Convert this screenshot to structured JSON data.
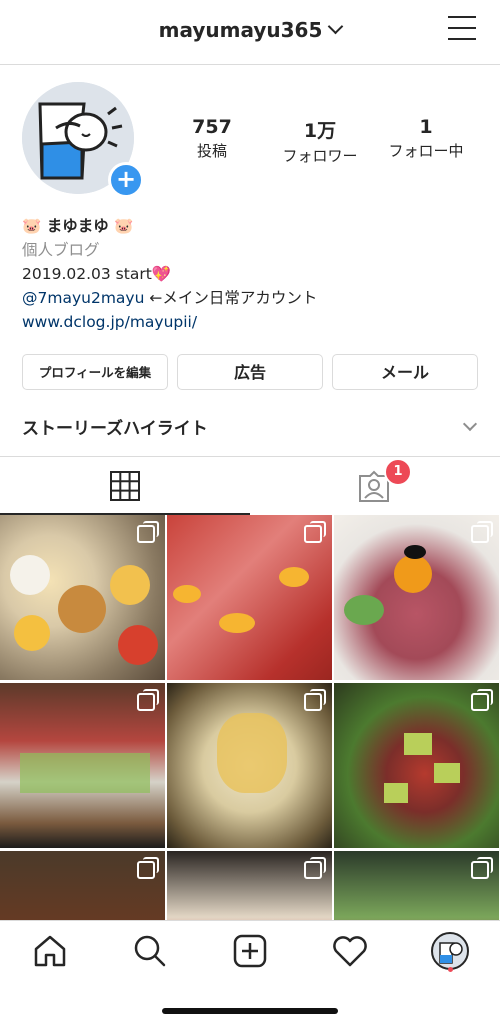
{
  "header": {
    "username": "mayumayu365"
  },
  "profile": {
    "stats": [
      {
        "num": "757",
        "label": "投稿"
      },
      {
        "num": "1万",
        "label": "フォロワー"
      },
      {
        "num": "1",
        "label": "フォロー中"
      }
    ],
    "display_name": "🐷 まゆまゆ 🐷",
    "category": "個人ブログ",
    "bio_line1": "2019.02.03 start💖",
    "bio_mention": "@7mayu2mayu",
    "bio_mention_suffix": " ←メイン日常アカウント",
    "website": "www.dclog.jp/mayupii/"
  },
  "buttons": {
    "edit": "プロフィールを編集",
    "ads": "広告",
    "mail": "メール"
  },
  "highlights": {
    "label": "ストーリーズハイライト"
  },
  "tabs": {
    "tagged_badge": "1",
    "icons": [
      "grid-icon",
      "tagged-person-icon"
    ]
  },
  "bottom_nav": {
    "icons": [
      "home-icon",
      "search-icon",
      "add-post-icon",
      "heart-icon",
      "profile-avatar-icon"
    ]
  },
  "colors": {
    "accent": "#3897f0",
    "notification": "#ed4956",
    "link": "#003569"
  }
}
